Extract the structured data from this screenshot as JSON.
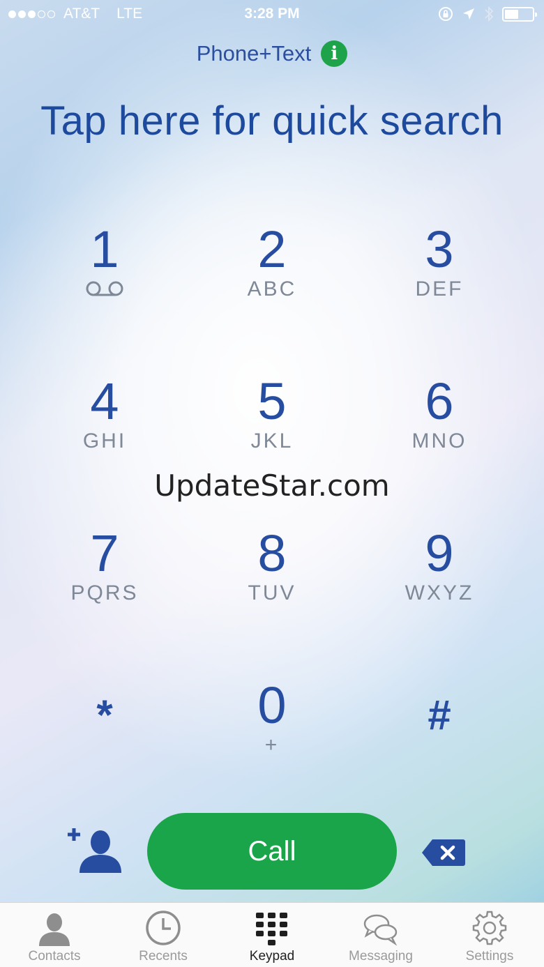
{
  "status_bar": {
    "carrier": "AT&T",
    "network": "LTE",
    "time": "3:28 PM",
    "signal_filled": 3,
    "signal_total": 5,
    "battery_level": 0.5
  },
  "header": {
    "app_name": "Phone+Text",
    "info_icon": "i"
  },
  "search": {
    "label": "Tap here for quick search"
  },
  "keypad": {
    "keys": [
      {
        "digit": "1",
        "letters": "",
        "icon": "voicemail-icon"
      },
      {
        "digit": "2",
        "letters": "ABC"
      },
      {
        "digit": "3",
        "letters": "DEF"
      },
      {
        "digit": "4",
        "letters": "GHI"
      },
      {
        "digit": "5",
        "letters": "JKL"
      },
      {
        "digit": "6",
        "letters": "MNO"
      },
      {
        "digit": "7",
        "letters": "PQRS"
      },
      {
        "digit": "8",
        "letters": "TUV"
      },
      {
        "digit": "9",
        "letters": "WXYZ"
      },
      {
        "digit": "*",
        "letters": ""
      },
      {
        "digit": "0",
        "letters": "+"
      },
      {
        "digit": "#",
        "letters": ""
      }
    ]
  },
  "watermark": "UpdateStar.com",
  "actions": {
    "call_label": "Call",
    "add_contact_icon": "add-contact-icon",
    "backspace_icon": "backspace-icon",
    "call_color": "#1aa54a"
  },
  "tabbar": {
    "tabs": [
      {
        "label": "Contacts",
        "icon": "person-icon"
      },
      {
        "label": "Recents",
        "icon": "clock-icon"
      },
      {
        "label": "Keypad",
        "icon": "keypad-grid-icon",
        "active": true
      },
      {
        "label": "Messaging",
        "icon": "chat-bubbles-icon"
      },
      {
        "label": "Settings",
        "icon": "gear-icon"
      }
    ]
  },
  "colors": {
    "accent_blue": "#274da0",
    "brand_green": "#1fa34a"
  }
}
